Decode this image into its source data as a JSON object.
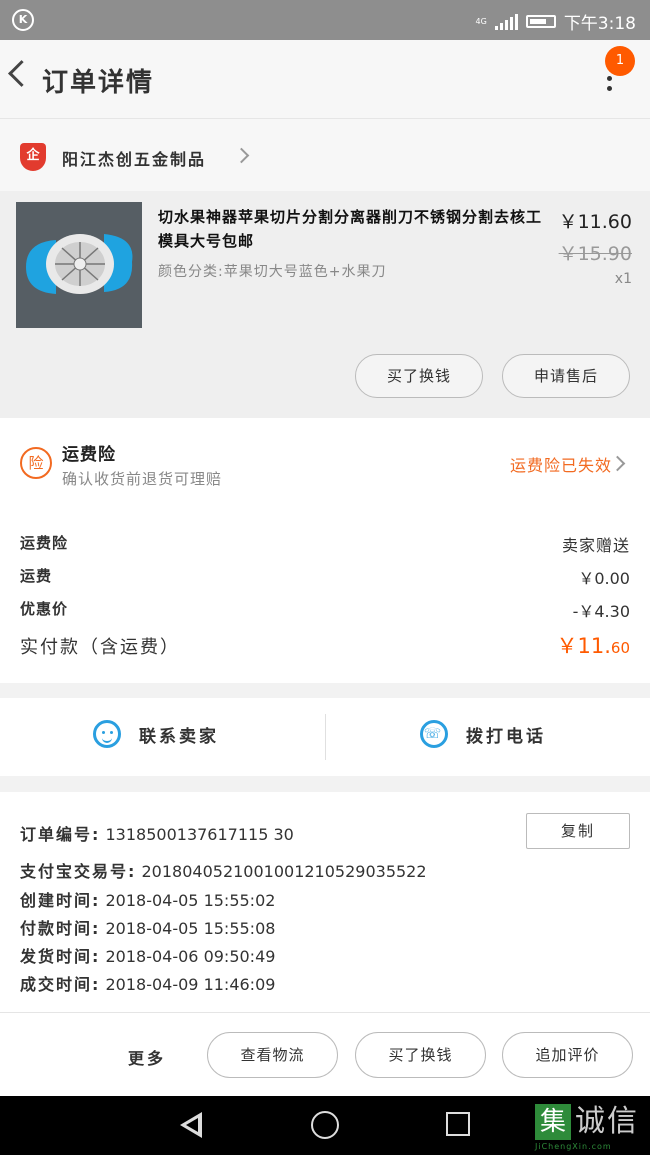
{
  "status_bar": {
    "network": "4G",
    "time": "下午3:18"
  },
  "header": {
    "title": "订单详情",
    "badge_count": "1"
  },
  "shop": {
    "name": "阳江杰创五金制品",
    "shield_glyph": "企"
  },
  "product": {
    "title": "切水果神器苹果切片分割分离器削刀不锈钢分割去核工模具大号包邮",
    "spec": "颜色分类:苹果切大号蓝色+水果刀",
    "price": "￥11.60",
    "original_price": "￥15.90",
    "quantity": "x1",
    "buttons": [
      "买了换钱",
      "申请售后"
    ]
  },
  "insurance": {
    "icon_glyph": "险",
    "title": "运费险",
    "subtitle": "确认收货前退货可理赔",
    "status": "运费险已失效"
  },
  "fees": [
    {
      "label": "运费险",
      "value": "卖家赠送"
    },
    {
      "label": "运费",
      "value": "￥0.00"
    },
    {
      "label": "优惠价",
      "value": "-￥4.30"
    }
  ],
  "total": {
    "label": "实付款（含运费）",
    "value_main": "￥11.",
    "value_cents": "60"
  },
  "contact": {
    "seller_label": "联系卖家",
    "phone_label": "拨打电话"
  },
  "order_info": {
    "copy_label": "复制",
    "lines": [
      {
        "label": "订单编号:",
        "value": "1318500137617115 30"
      },
      {
        "label": "支付宝交易号:",
        "value": "2018040521001001210529035522"
      },
      {
        "label": "创建时间:",
        "value": "2018-04-05 15:55:02"
      },
      {
        "label": "付款时间:",
        "value": "2018-04-05 15:55:08"
      },
      {
        "label": "发货时间:",
        "value": "2018-04-06 09:50:49"
      },
      {
        "label": "成交时间:",
        "value": "2018-04-09 11:46:09"
      }
    ]
  },
  "actions": {
    "more_label": "更多",
    "buttons": [
      "查看物流",
      "买了换钱",
      "追加评价"
    ]
  },
  "watermark": {
    "box": "集",
    "text": "诚信",
    "url": "JiChengXin.com"
  },
  "colors": {
    "accent": "#ff5a00",
    "insurance": "#f26a21",
    "contact_icon": "#2a9fe0"
  }
}
